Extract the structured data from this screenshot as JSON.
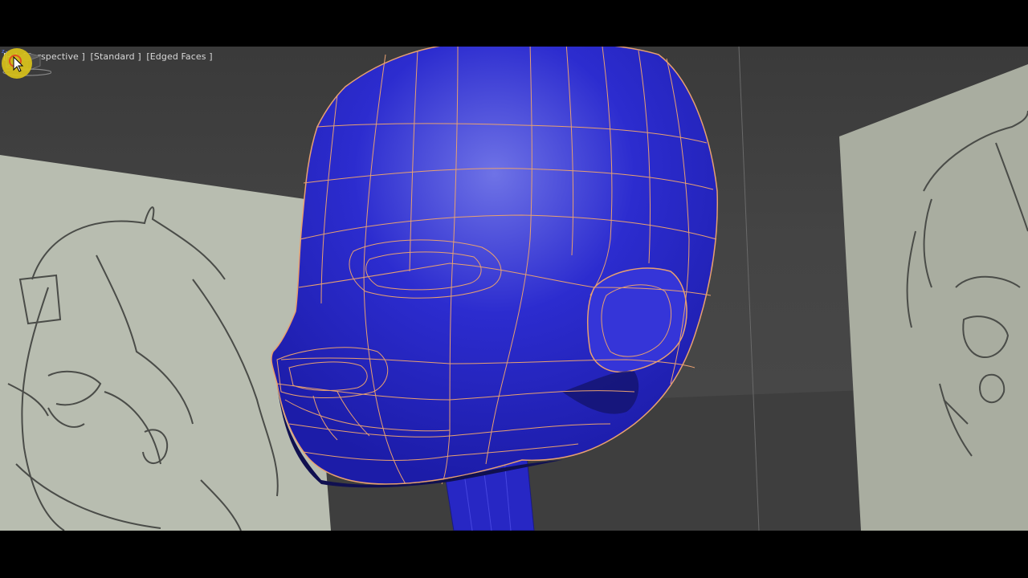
{
  "viewport": {
    "menu_plus": "[+]",
    "view_type": "[Perspective ]",
    "shading": "[Standard ]",
    "display_mode": "[Edged Faces ]"
  },
  "colors": {
    "mesh_fill": "#2c2ccf",
    "mesh_edges": "#e8a070",
    "reference_plane": "#b8bdb0",
    "sketch_lines": "#4a4c48",
    "cursor_highlight": "#d9c21a"
  },
  "icons": {
    "viewcube": "viewcube-icon",
    "axis": "axis-tripod-icon",
    "cursor": "mouse-cursor-icon"
  }
}
